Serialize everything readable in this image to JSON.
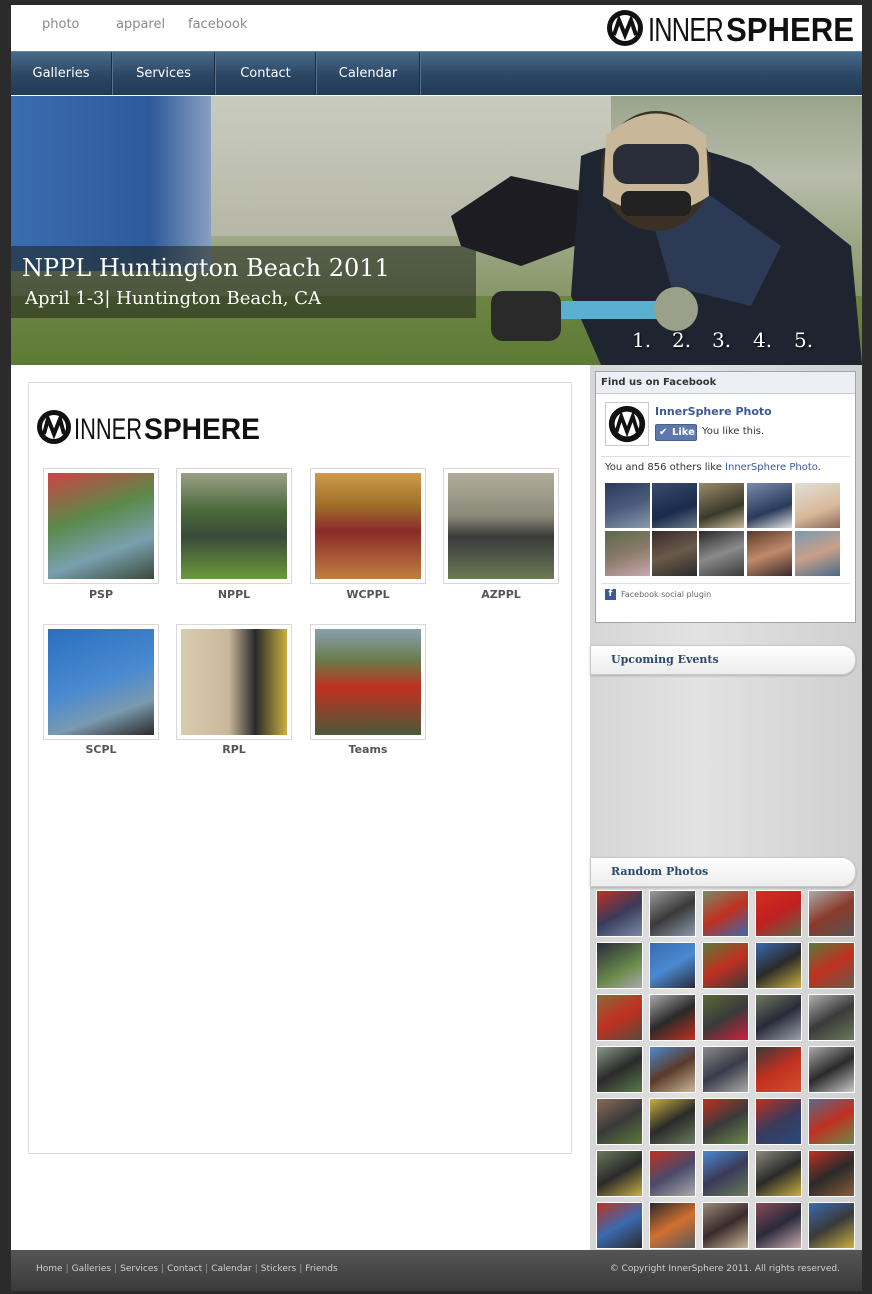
{
  "toplinks": [
    "photo",
    "apparel",
    "facebook"
  ],
  "logo": {
    "inner": "INNER",
    "sphere": "SPHERE"
  },
  "nav": [
    "Galleries",
    "Services",
    "Contact",
    "Calendar"
  ],
  "hero": {
    "title": "NPPL Huntington Beach 2011",
    "subtitle": "April 1-3| Huntington Beach, CA",
    "pager": [
      "1.",
      "2.",
      "3.",
      "4.",
      "5."
    ]
  },
  "galleries": [
    {
      "label": "PSP",
      "color": "#5a8a4a"
    },
    {
      "label": "NPPL",
      "color": "#4f7a3f"
    },
    {
      "label": "WCPPL",
      "color": "#a0702a"
    },
    {
      "label": "AZPPL",
      "color": "#6b7a55"
    },
    {
      "label": "SCPL",
      "color": "#2a6fbf"
    },
    {
      "label": "RPL",
      "color": "#c9b79a"
    },
    {
      "label": "Teams",
      "color": "#6a7a4a"
    }
  ],
  "facebook": {
    "header": "Find us on Facebook",
    "page_name": "InnerSphere Photo",
    "like_label": "Like",
    "you_like": "You like this.",
    "count_prefix": "You and 856 others like ",
    "count_link": "InnerSphere Photo",
    "count_suffix": ".",
    "plugin": "Facebook social plugin"
  },
  "sidebar": {
    "upcoming": "Upcoming Events",
    "random": "Random Photos"
  },
  "footer": {
    "links": [
      "Home",
      "Galleries",
      "Services",
      "Contact",
      "Calendar",
      "Stickers",
      "Friends"
    ],
    "copyright": "© Copyright InnerSphere 2011.  All rights reserved."
  }
}
